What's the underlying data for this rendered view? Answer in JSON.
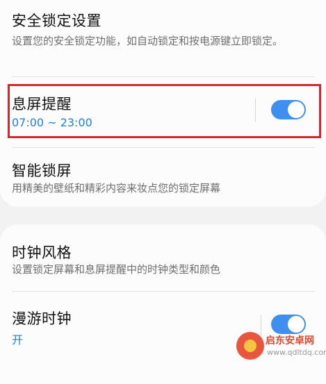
{
  "security_lock": {
    "title": "安全锁定设置",
    "description": "设置您的安全锁定功能，如自动锁定和按电源键立即锁定。"
  },
  "aod": {
    "title": "息屏提醒",
    "schedule": "07:00 ~ 23:00",
    "enabled": true
  },
  "smart_lock": {
    "title": "智能锁屏",
    "description": "用精美的壁纸和精彩内容来妆点您的锁定屏幕"
  },
  "clock_style": {
    "title": "时钟风格",
    "description": "设置锁定屏幕和息屏提醒中的时钟类型和颜色"
  },
  "roaming_clock": {
    "title": "漫游时钟",
    "status": "开",
    "enabled": true
  },
  "watermark": {
    "name": "启东安卓网",
    "url": "www.qdltdq.com"
  },
  "colors": {
    "accent": "#3e8ff0",
    "highlight": "#d9262b",
    "subtext_blue": "#1f7fd1"
  }
}
